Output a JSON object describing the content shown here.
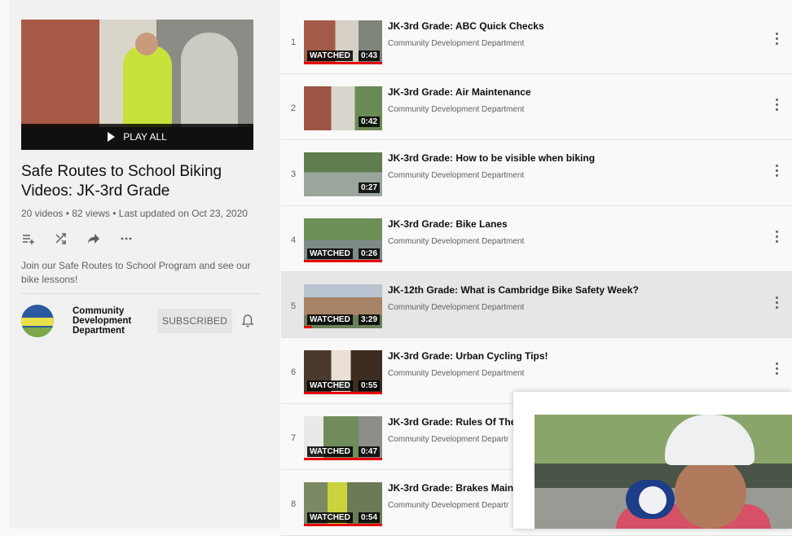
{
  "playlist": {
    "play_all": "PLAY ALL",
    "title": "Safe Routes to School Biking Videos: JK-3rd Grade",
    "stats": "20 videos • 82 views • Last updated on Oct 23, 2020",
    "description": "Join our Safe Routes to School Program and see our bike lessons!",
    "owner": "Community Development Department",
    "subscribe_label": "SUBSCRIBED"
  },
  "icons": {
    "actions": [
      "add-to-queue-icon",
      "shuffle-icon",
      "share-icon",
      "more-horizontal-icon"
    ],
    "notify": "bell-icon",
    "row_menu": "more-vertical-icon"
  },
  "colors": {
    "progress": "#e60000",
    "active_row": "#e6e6e6"
  },
  "videos": [
    {
      "index": "1",
      "title": "JK-3rd Grade: ABC Quick Checks",
      "channel": "Community Development Department",
      "watched": "WATCHED",
      "duration": "0:43",
      "progress": 1.0
    },
    {
      "index": "2",
      "title": "JK-3rd Grade: Air Maintenance",
      "channel": "Community Development Department",
      "watched": "",
      "duration": "0:42",
      "progress": 0
    },
    {
      "index": "3",
      "title": "JK-3rd Grade: How to be visible when biking",
      "channel": "Community Development Department",
      "watched": "",
      "duration": "0:27",
      "progress": 0
    },
    {
      "index": "4",
      "title": "JK-3rd Grade: Bike Lanes",
      "channel": "Community Development Department",
      "watched": "WATCHED",
      "duration": "0:26",
      "progress": 1.0
    },
    {
      "index": "5",
      "title": "JK-12th Grade: What is Cambridge Bike Safety Week?",
      "channel": "Community Development Department",
      "watched": "WATCHED",
      "duration": "3:29",
      "progress": 0.1
    },
    {
      "index": "6",
      "title": "JK-3rd Grade: Urban Cycling Tips!",
      "channel": "Community Development Department",
      "watched": "WATCHED",
      "duration": "0:55",
      "progress": 1.0
    },
    {
      "index": "7",
      "title": "JK-3rd Grade: Rules Of The",
      "channel": "Community Development Departr",
      "watched": "WATCHED",
      "duration": "0:47",
      "progress": 1.0
    },
    {
      "index": "8",
      "title": "JK-3rd Grade: Brakes Maint",
      "channel": "Community Development Departr",
      "watched": "WATCHED",
      "duration": "0:54",
      "progress": 1.0
    }
  ]
}
